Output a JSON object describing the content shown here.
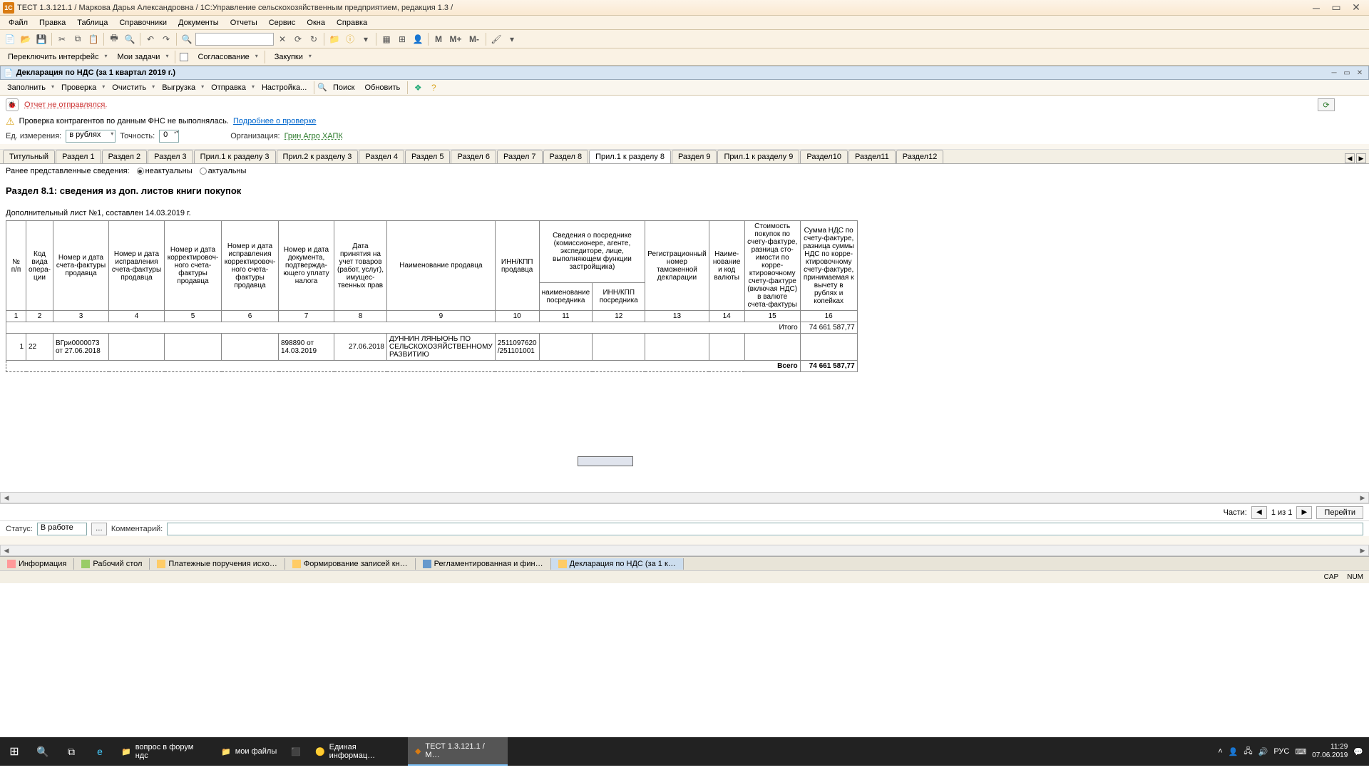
{
  "titlebar": {
    "title": "ТЕСТ 1.3.121.1 / Маркова Дарья Александровна / 1С:Управление сельскохозяйственным предприятием, редакция 1.3 /"
  },
  "menu": [
    "Файл",
    "Правка",
    "Таблица",
    "Справочники",
    "Документы",
    "Отчеты",
    "Сервис",
    "Окна",
    "Справка"
  ],
  "toolbar_m": [
    "M",
    "M+",
    "M-"
  ],
  "toolbar2": {
    "switch": "Переключить интерфейс",
    "tasks": "Мои задачи",
    "agree": "Согласование",
    "buy": "Закупки"
  },
  "doc_title": "Декларация по НДС (за 1 квартал 2019 г.)",
  "actions": {
    "fill": "Заполнить",
    "check": "Проверка",
    "clear": "Очистить",
    "upload": "Выгрузка",
    "send": "Отправка",
    "setup": "Настройка...",
    "search": "Поиск",
    "refresh": "Обновить"
  },
  "status_line": "Отчет не отправлялся.",
  "warn_line": "Проверка контрагентов по данным ФНС не выполнялась.",
  "warn_link": "Подробнее о проверке",
  "params": {
    "unit_lbl": "Ед. измерения:",
    "unit_val": "в рублях",
    "prec_lbl": "Точность:",
    "prec_val": "0",
    "org_lbl": "Организация:",
    "org_val": "Грин Агро ХАПК"
  },
  "tabs": [
    "Титульный",
    "Раздел 1",
    "Раздел 2",
    "Раздел 3",
    "Прил.1 к разделу 3",
    "Прил.2 к разделу 3",
    "Раздел 4",
    "Раздел 5",
    "Раздел 6",
    "Раздел 7",
    "Раздел 8",
    "Прил.1 к разделу 8",
    "Раздел 9",
    "Прил.1 к разделу 9",
    "Раздел10",
    "Раздел11",
    "Раздел12"
  ],
  "active_tab_index": 11,
  "filter": {
    "label": "Ранее представленные сведения:",
    "opt1": "неактуальны",
    "opt2": "актуальны"
  },
  "section_title": "Раздел 8.1: сведения из доп. листов книги покупок",
  "subtitle": "Дополнительный лист №1, составлен 14.03.2019 г.",
  "headers": {
    "c1": "№ п/п",
    "c2": "Код вида опера-ции",
    "c3": "Номер и дата счета-фактуры продавца",
    "c4": "Номер и дата исправления счета-фактуры продавца",
    "c5": "Номер и дата корректировоч-ного счета-фактуры продавца",
    "c6": "Номер и дата исправления корректировоч-ного счета-фактуры продавца",
    "c7": "Номер и дата документа, подтвержда-ющего уплату налога",
    "c8": "Дата принятия на учет товаров (работ, услуг), имущес-твенных прав",
    "c9": "Наименование продавца",
    "c10": "ИНН/КПП продавца",
    "c11": "Сведения о посреднике (комиссионере, агенте, экспедиторе, лице, выполняющем функции застройщика)",
    "c11a": "наименование посредника",
    "c11b": "ИНН/КПП посредника",
    "c12": "Регистрационный номер таможенной декларации",
    "c13": "Наиме-нование и код валюты",
    "c14": "Стоимость покупок по счету-фактуре, разница сто-имости по корре-ктировочному счету-фактуре (включая НДС) в валюте счета-фактуры",
    "c15": "Сумма НДС по счету-фактуре, разница суммы НДС по корре-ктировочному счету-фактуре, принимаемая к вычету в рублях и копейках"
  },
  "colnums": [
    "1",
    "2",
    "3",
    "4",
    "5",
    "6",
    "7",
    "8",
    "9",
    "10",
    "11",
    "12",
    "13",
    "14",
    "15",
    "16"
  ],
  "totals": {
    "itogo_lbl": "Итого",
    "itogo_val": "74 661 587,77",
    "vsego_lbl": "Всего",
    "vsego_val": "74 661 587,77"
  },
  "row": {
    "n": "1",
    "code": "22",
    "sf": "ВГри0000073 от 27.06.2018",
    "doc": "898890 от 14.03.2019",
    "date": "27.06.2018",
    "name": "ДУННИН ЛЯНЬЮНЬ ПО СЕЛЬСКОХОЗЯЙСТВЕННОМУ РАЗВИТИЮ",
    "inn": "2511097620 /251101001"
  },
  "nav": {
    "parts": "Части:",
    "count": "1 из 1",
    "go": "Перейти",
    "status_lbl": "Статус:",
    "status_val": "В работе",
    "comment_lbl": "Комментарий:"
  },
  "bottom_tabs": [
    "Информация",
    "Рабочий стол",
    "Платежные поручения исхо…",
    "Формирование записей кн…",
    "Регламентированная и фин…",
    "Декларация по НДС (за 1 к…"
  ],
  "statusbar": {
    "cap": "CAP",
    "num": "NUM"
  },
  "taskbar": {
    "items": [
      "вопрос в форум ндс",
      "мои файлы",
      "",
      "Единая информац…",
      "ТЕСТ 1.3.121.1 / М…"
    ],
    "lang": "РУС",
    "time": "11:29",
    "date": "07.06.2019"
  }
}
